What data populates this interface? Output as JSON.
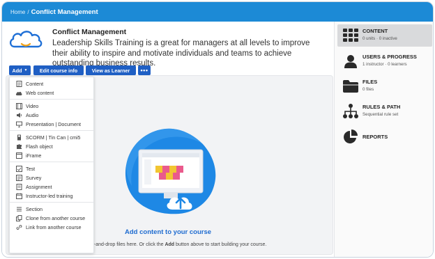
{
  "breadcrumb": {
    "home": "Home",
    "separator": "/",
    "current": "Conflict Management"
  },
  "course": {
    "title": "Conflict Management",
    "description": "Leadership Skills Training is a great for managers at all levels to improve their ability to inspire and motivate individuals and teams to achieve outstanding business results."
  },
  "toolbar": {
    "add_label": "Add",
    "edit_label": "Edit course info",
    "view_label": "View as Learner",
    "more_label": "•••"
  },
  "add_menu": [
    {
      "label": "Content",
      "icon": "content-icon"
    },
    {
      "label": "Web content",
      "icon": "cloud-icon"
    },
    {
      "label": "Video",
      "icon": "film-icon"
    },
    {
      "label": "Audio",
      "icon": "speaker-icon"
    },
    {
      "label": "Presentation | Document",
      "icon": "presentation-icon"
    },
    {
      "label": "SCORM | Tin Can | cmi5",
      "icon": "package-icon"
    },
    {
      "label": "Flash object",
      "icon": "puzzle-icon"
    },
    {
      "label": "iFrame",
      "icon": "iframe-icon"
    },
    {
      "label": "Test",
      "icon": "test-icon"
    },
    {
      "label": "Survey",
      "icon": "survey-icon"
    },
    {
      "label": "Assignment",
      "icon": "assignment-icon"
    },
    {
      "label": "Instructor-led training",
      "icon": "calendar-icon"
    },
    {
      "label": "Section",
      "icon": "section-icon"
    },
    {
      "label": "Clone from another course",
      "icon": "clone-icon"
    },
    {
      "label": "Link from another course",
      "icon": "link-icon"
    }
  ],
  "empty_state": {
    "heading": "Add content to your course",
    "hint_before": "g-and-drop files here. Or click the ",
    "hint_bold": "Add",
    "hint_after": " button above to start building your course."
  },
  "sidebar": {
    "items": [
      {
        "title": "CONTENT",
        "subtitle": "0 units · 0 inactive",
        "icon": "grid-icon",
        "active": true
      },
      {
        "title": "USERS & PROGRESS",
        "subtitle": "1 instructor · 0 learners",
        "icon": "user-icon",
        "active": false
      },
      {
        "title": "FILES",
        "subtitle": "0 files",
        "icon": "folder-icon",
        "active": false
      },
      {
        "title": "RULES & PATH",
        "subtitle": "Sequential rule set",
        "icon": "network-icon",
        "active": false
      },
      {
        "title": "REPORTS",
        "subtitle": "",
        "icon": "pie-chart-icon",
        "active": false
      }
    ]
  },
  "colors": {
    "topbar": "#1c8ad6",
    "button": "#1f5fc4",
    "heading_link": "#1f6cd0",
    "illustration_blue": "#1e88e5",
    "puzzle_yellow": "#f2c531",
    "puzzle_pink": "#ea5a8c"
  }
}
